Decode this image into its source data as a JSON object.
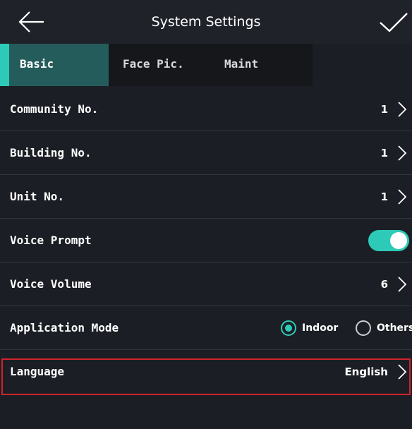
{
  "header": {
    "title": "System Settings",
    "back_icon": "arrow-left-icon",
    "confirm_icon": "checkmark-icon"
  },
  "tabs": [
    {
      "label": "Basic",
      "active": true
    },
    {
      "label": "Face Pic.",
      "active": false
    },
    {
      "label": "Maint",
      "active": false
    }
  ],
  "settings": {
    "community_no": {
      "label": "Community No.",
      "value": "1"
    },
    "building_no": {
      "label": "Building No.",
      "value": "1"
    },
    "unit_no": {
      "label": "Unit No.",
      "value": "1"
    },
    "voice_prompt": {
      "label": "Voice Prompt",
      "enabled": true
    },
    "voice_volume": {
      "label": "Voice Volume",
      "value": "6"
    },
    "application_mode": {
      "label": "Application Mode",
      "options": [
        "Indoor",
        "Others"
      ],
      "selected": "Indoor"
    },
    "language": {
      "label": "Language",
      "value": "English",
      "highlighted": true
    }
  },
  "colors": {
    "accent": "#2dcbb7",
    "background": "#1b1e24",
    "active_tab": "#245c5b",
    "highlight_border": "#d0232e"
  }
}
